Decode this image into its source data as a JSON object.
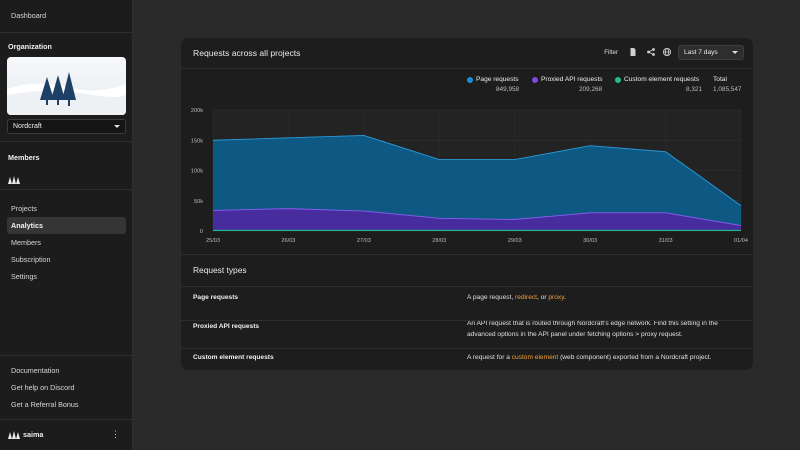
{
  "sidebar": {
    "top_link": "Dashboard",
    "organization_heading": "Organization",
    "org_name": "Nordcraft",
    "members_heading": "Members",
    "nav": [
      {
        "label": "Projects",
        "active": false
      },
      {
        "label": "Analytics",
        "active": true
      },
      {
        "label": "Members",
        "active": false
      },
      {
        "label": "Subscription",
        "active": false
      },
      {
        "label": "Settings",
        "active": false
      }
    ],
    "footer_links": [
      "Documentation",
      "Get help on Discord",
      "Get a Referral Bonus"
    ],
    "user_name": "saima"
  },
  "panel": {
    "title": "Requests across all projects",
    "filter_label": "Filter",
    "range_value": "Last 7 days",
    "legend": [
      {
        "name": "Page requests",
        "value": "849,958",
        "color": "#1a8fd6"
      },
      {
        "name": "Proxied API requests",
        "value": "209,268",
        "color": "#7a4be0"
      },
      {
        "name": "Custom element requests",
        "value": "8,321",
        "color": "#1fbf86"
      },
      {
        "name": "Total",
        "value": "1,085,547",
        "color": ""
      }
    ],
    "request_types_title": "Request types",
    "request_types": [
      {
        "name": "Page requests",
        "desc_parts": [
          {
            "text": "A page request, ",
            "hl": false
          },
          {
            "text": "redirect",
            "hl": true
          },
          {
            "text": ", or ",
            "hl": false
          },
          {
            "text": "proxy",
            "hl": true
          },
          {
            "text": ".",
            "hl": false
          }
        ]
      },
      {
        "name": "Proxied API requests",
        "desc_parts": [
          {
            "text": "An API request that is routed through Nordcraft's edge network. Find this setting in the advanced options in the API panel under fetching options > proxy request.",
            "hl": false
          }
        ]
      },
      {
        "name": "Custom element requests",
        "desc_parts": [
          {
            "text": "A request for a ",
            "hl": false
          },
          {
            "text": "custom element",
            "hl": true
          },
          {
            "text": " (web component) exported from a Nordcraft project.",
            "hl": false
          }
        ]
      }
    ]
  },
  "chart_data": {
    "type": "area",
    "stacked": false,
    "x": [
      "25/03",
      "26/03",
      "27/03",
      "28/03",
      "29/03",
      "30/03",
      "31/03",
      "01/04"
    ],
    "y_ticks": [
      "0",
      "50k",
      "100k",
      "150k",
      "200k"
    ],
    "ylim": [
      0,
      200000
    ],
    "grid": true,
    "legend_position": "top-right",
    "series": [
      {
        "name": "Page requests",
        "color": "#0d5d8a",
        "line": "#2a9ad8",
        "values": [
          150000,
          154000,
          158000,
          118000,
          118000,
          141000,
          131000,
          42000
        ]
      },
      {
        "name": "Proxied API requests",
        "color": "#4b2a9e",
        "line": "#8a5cf0",
        "values": [
          34000,
          37000,
          33000,
          21000,
          19000,
          30000,
          30000,
          9000
        ]
      },
      {
        "name": "Custom element requests",
        "color": "#1fbf86",
        "line": "#1fbf86",
        "values": [
          1200,
          1200,
          1200,
          1200,
          1200,
          1200,
          1200,
          1200
        ]
      }
    ]
  }
}
